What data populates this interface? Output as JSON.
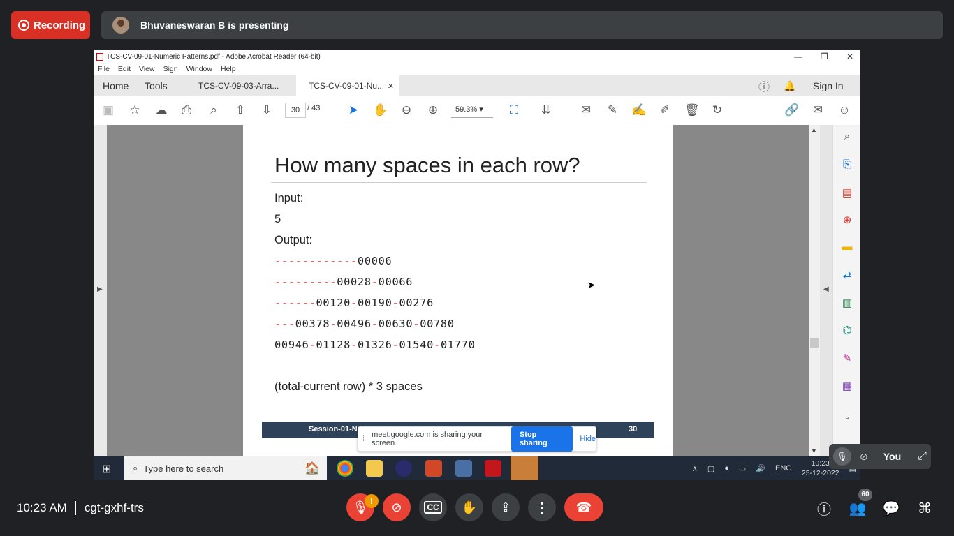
{
  "meet": {
    "recording_label": "Recording",
    "presenter_label": "Bhuvaneswaran B is presenting",
    "time": "10:23 AM",
    "meeting_code": "cgt-gxhf-trs",
    "participant_count": "60",
    "self_label": "You",
    "share_notice": "meet.google.com is sharing your screen.",
    "stop_sharing_label": "Stop sharing",
    "hide_label": "Hide"
  },
  "acrobat": {
    "window_title": "TCS-CV-09-01-Numeric Patterns.pdf - Adobe Acrobat Reader (64-bit)",
    "menu": [
      "File",
      "Edit",
      "View",
      "Sign",
      "Window",
      "Help"
    ],
    "tabs": {
      "home": "Home",
      "tools": "Tools",
      "doc1": "TCS-CV-09-03-Arra...",
      "doc2": "TCS-CV-09-01-Nu..."
    },
    "sign_in": "Sign In",
    "current_page": "30",
    "total_pages": "/ 43",
    "zoom": "59.3%"
  },
  "slide": {
    "title": "How many spaces in each row?",
    "input_label": "Input:",
    "input_value": "5",
    "output_label": "Output:",
    "rows": [
      [
        {
          "t": "------------",
          "d": true
        },
        {
          "t": "00006",
          "d": false
        }
      ],
      [
        {
          "t": "---------",
          "d": true
        },
        {
          "t": "00028",
          "d": false
        },
        {
          "t": "-",
          "d": true
        },
        {
          "t": "00066",
          "d": false
        }
      ],
      [
        {
          "t": "------",
          "d": true
        },
        {
          "t": "00120",
          "d": false
        },
        {
          "t": "-",
          "d": true
        },
        {
          "t": "00190",
          "d": false
        },
        {
          "t": "-",
          "d": true
        },
        {
          "t": "00276",
          "d": false
        }
      ],
      [
        {
          "t": "---",
          "d": true
        },
        {
          "t": "00378",
          "d": false
        },
        {
          "t": "-",
          "d": true
        },
        {
          "t": "00496",
          "d": false
        },
        {
          "t": "-",
          "d": true
        },
        {
          "t": "00630",
          "d": false
        },
        {
          "t": "-",
          "d": true
        },
        {
          "t": "00780",
          "d": false
        }
      ],
      [
        {
          "t": "00946",
          "d": false
        },
        {
          "t": "-",
          "d": true
        },
        {
          "t": "01128",
          "d": false
        },
        {
          "t": "-",
          "d": true
        },
        {
          "t": "01326",
          "d": false
        },
        {
          "t": "-",
          "d": true
        },
        {
          "t": "01540",
          "d": false
        },
        {
          "t": "-",
          "d": true
        },
        {
          "t": "01770",
          "d": false
        }
      ]
    ],
    "formula": "(total-current row) * 3 spaces",
    "footer_left": "Session-01-Nu",
    "footer_page": "30"
  },
  "taskbar": {
    "search_placeholder": "Type here to search",
    "lang": "ENG",
    "clock_time": "10:23",
    "clock_date": "25-12-2022"
  },
  "colors": {
    "recording": "#d93025",
    "end_call": "#ea4335",
    "accent": "#1a73e8",
    "dash_red": "#d93025",
    "footer_band": "#2e4259"
  }
}
